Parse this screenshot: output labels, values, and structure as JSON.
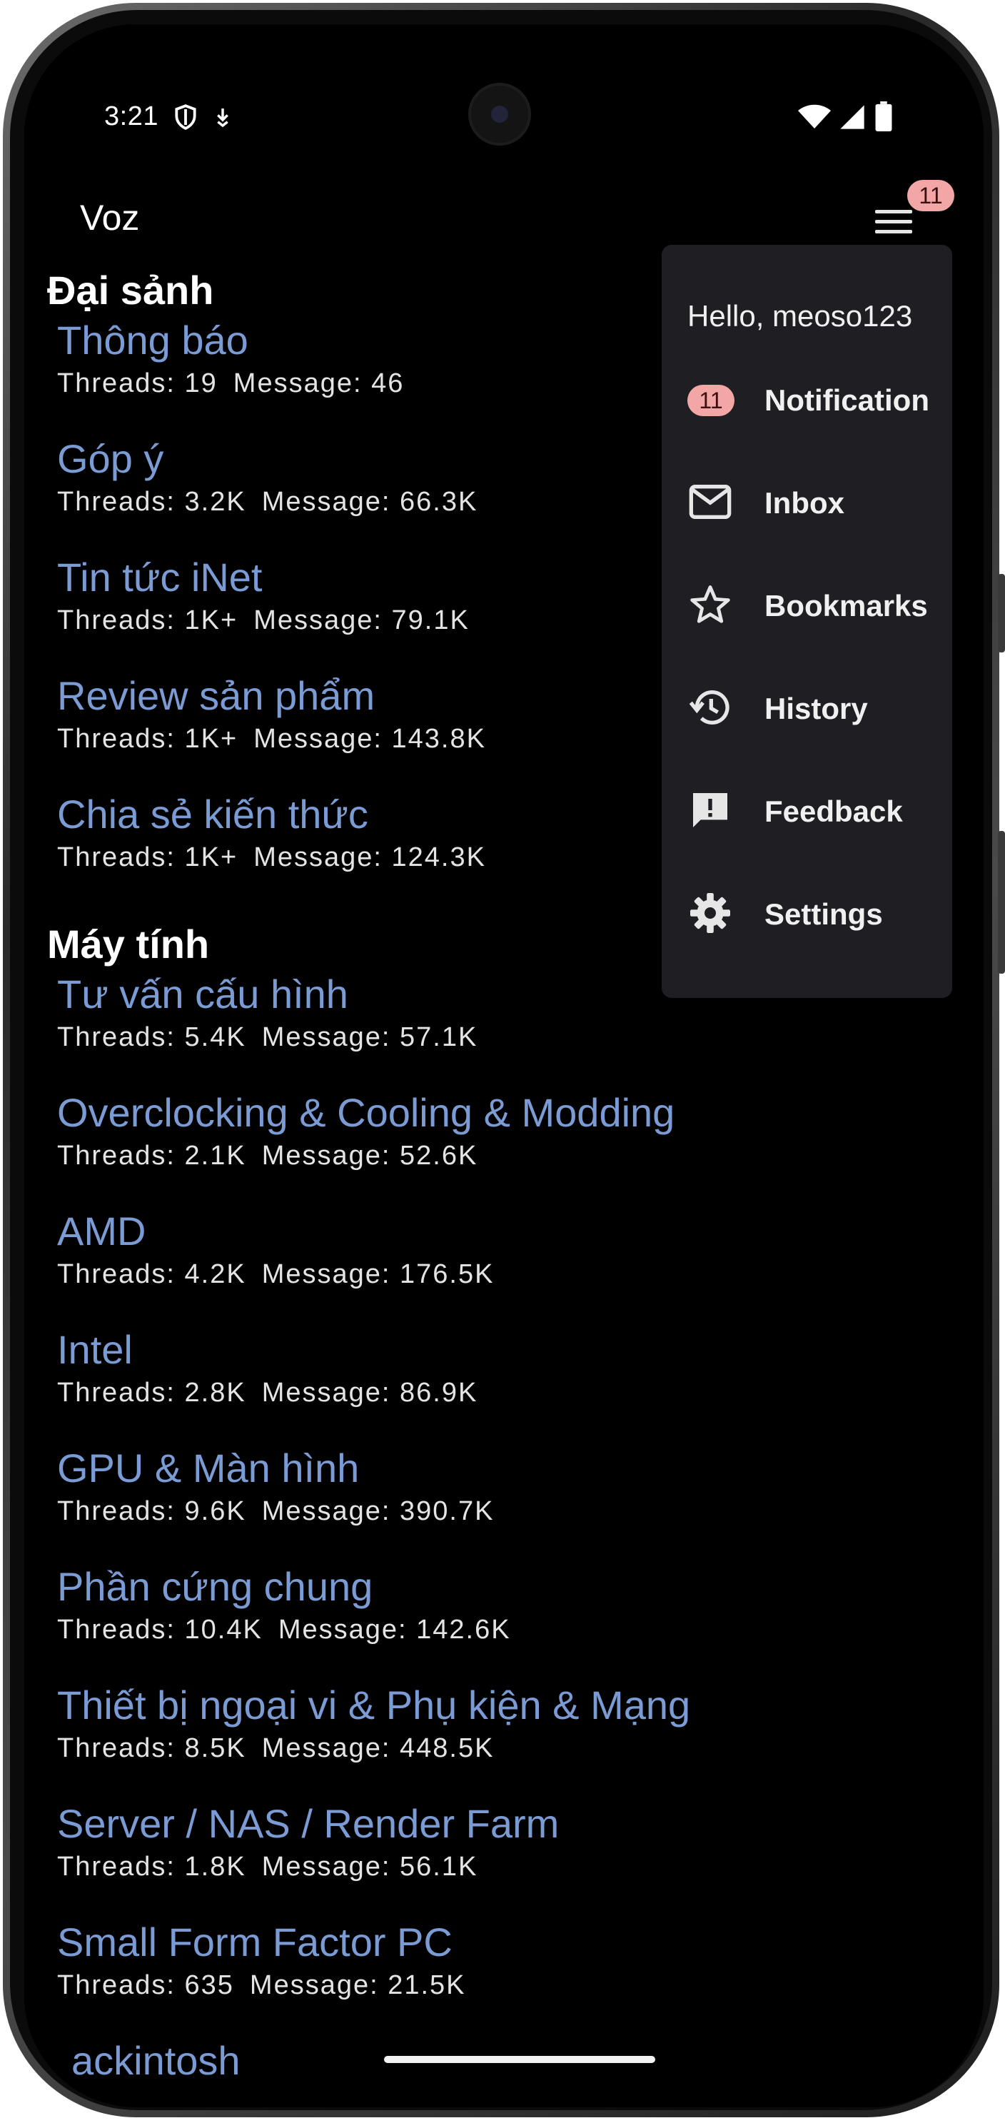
{
  "status_bar": {
    "time": "3:21",
    "left_icons": [
      "shield-icon",
      "download-arrow-icon"
    ],
    "right_icons": [
      "wifi-icon",
      "signal-icon",
      "battery-icon"
    ]
  },
  "app_bar": {
    "title": "Voz",
    "menu_icon": "hamburger-menu-icon",
    "badge_count": "11"
  },
  "sections": [
    {
      "title": "Đại sảnh",
      "forums": [
        {
          "name": "Thông báo",
          "threads": "Threads: 19",
          "messages": "Message: 46"
        },
        {
          "name": "Góp ý",
          "threads": "Threads: 3.2K",
          "messages": "Message: 66.3K"
        },
        {
          "name": "Tin tức iNet",
          "threads": "Threads: 1K+",
          "messages": "Message: 79.1K"
        },
        {
          "name": "Review sản phẩm",
          "threads": "Threads: 1K+",
          "messages": "Message: 143.8K"
        },
        {
          "name": "Chia sẻ kiến thức",
          "threads": "Threads: 1K+",
          "messages": "Message: 124.3K"
        }
      ]
    },
    {
      "title": "Máy tính",
      "forums": [
        {
          "name": "Tư vấn cấu hình",
          "threads": "Threads: 5.4K",
          "messages": "Message: 57.1K"
        },
        {
          "name": "Overclocking & Cooling & Modding",
          "threads": "Threads: 2.1K",
          "messages": "Message: 52.6K"
        },
        {
          "name": "AMD",
          "threads": "Threads: 4.2K",
          "messages": "Message: 176.5K"
        },
        {
          "name": "Intel",
          "threads": "Threads: 2.8K",
          "messages": "Message: 86.9K"
        },
        {
          "name": "GPU & Màn hình",
          "threads": "Threads: 9.6K",
          "messages": "Message: 390.7K"
        },
        {
          "name": "Phần cứng chung",
          "threads": "Threads: 10.4K",
          "messages": "Message: 142.6K"
        },
        {
          "name": "Thiết bị ngoại vi & Phụ kiện & Mạng",
          "threads": "Threads: 8.5K",
          "messages": "Message: 448.5K"
        },
        {
          "name": "Server / NAS / Render Farm",
          "threads": "Threads: 1.8K",
          "messages": "Message: 56.1K"
        },
        {
          "name": "Small Form Factor PC",
          "threads": "Threads: 635",
          "messages": "Message: 21.5K"
        },
        {
          "name": "ackintosh"
        }
      ]
    }
  ],
  "menu": {
    "greeting": "Hello, meoso123",
    "items": [
      {
        "label": "Notification",
        "icon": "notification-count-badge",
        "badge": "11"
      },
      {
        "label": "Inbox",
        "icon": "mail-icon"
      },
      {
        "label": "Bookmarks",
        "icon": "star-icon"
      },
      {
        "label": "History",
        "icon": "history-icon"
      },
      {
        "label": "Feedback",
        "icon": "feedback-icon"
      },
      {
        "label": "Settings",
        "icon": "gear-icon"
      }
    ]
  },
  "colors": {
    "background": "#000000",
    "forum_link": "#7b9bd4",
    "menu_surface": "#1e1e23",
    "badge": "#f3a6a6"
  }
}
